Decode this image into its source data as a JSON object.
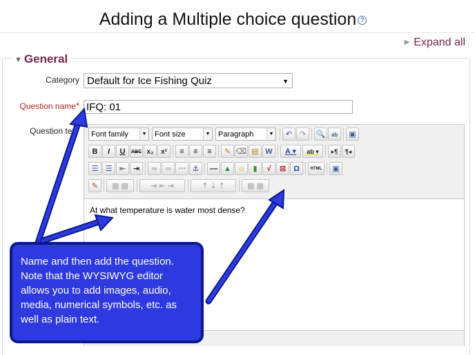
{
  "page": {
    "title": "Adding a Multiple choice question",
    "help_icon": "?",
    "expand_all": "Expand all"
  },
  "form": {
    "section": "General",
    "category_label": "Category",
    "category_value": "Default for Ice Fishing Quiz",
    "question_name_label": "Question name",
    "required_mark": "*",
    "question_name_value": "IFQ: 01",
    "question_text_label": "Question tex"
  },
  "editor": {
    "font_family": "Font family",
    "font_size": "Font size",
    "format": "Paragraph",
    "content": "At what temperature is water most dense?",
    "icons": [
      "undo-icon",
      "redo-icon",
      "find-icon",
      "replace-icon",
      "fullscreen-icon",
      "bold-icon",
      "italic-icon",
      "underline-icon",
      "strikethrough-icon",
      "subscript-icon",
      "superscript-icon",
      "align-left-icon",
      "align-center-icon",
      "align-right-icon",
      "clean-icon",
      "remove-format-icon",
      "paste-text-icon",
      "paste-word-icon",
      "text-color-icon",
      "highlight-icon",
      "ltr-icon",
      "rtl-icon",
      "bullet-list-icon",
      "number-list-icon",
      "outdent-icon",
      "indent-icon",
      "link-icon",
      "unlink-icon",
      "nonbreak-icon",
      "anchor-icon",
      "hr-icon",
      "image-icon",
      "emoticon-icon",
      "media-icon",
      "equation-icon",
      "cross-icon",
      "omega-icon",
      "html-icon",
      "template-icon",
      "edit-icon",
      "table-icon"
    ]
  },
  "callout": {
    "text": "Name and then add the question. Note that the WYSIWYG editor allows you to add images, audio, media, numerical symbols, etc. as well as plain text."
  },
  "colors": {
    "accent": "#7a2346",
    "callout_fill": "#2e3ae0",
    "callout_border": "#0a1a8a"
  }
}
